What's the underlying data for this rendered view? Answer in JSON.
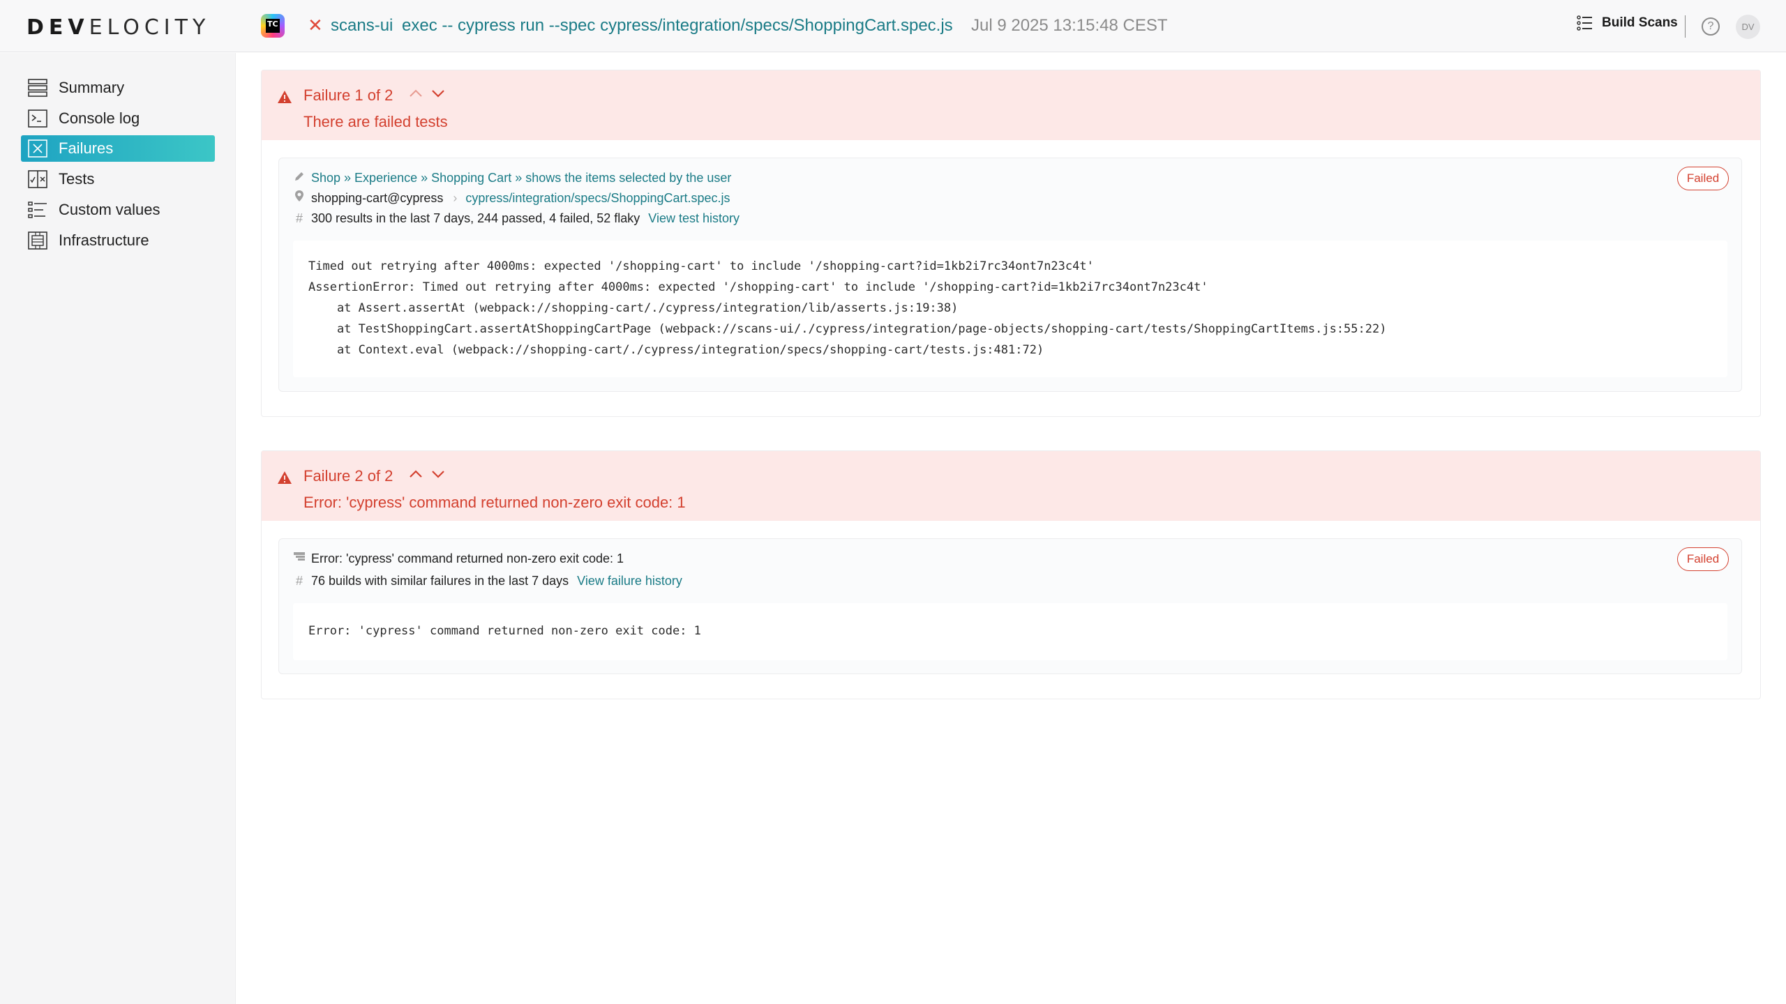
{
  "header": {
    "logo_bold": "DEV",
    "logo_light": "ELOCITY",
    "ci_logo_text": "TC",
    "status_icon": "x-icon",
    "project": "scans-ui",
    "command": "exec -- cypress run --spec cypress/integration/specs/ShoppingCart.spec.js",
    "timestamp": "Jul 9 2025 13:15:48 CEST",
    "build_scans_label": "Build Scans",
    "help_label": "?",
    "avatar_initials": "DV"
  },
  "sidebar": {
    "items": [
      {
        "label": "Summary",
        "icon": "summary-icon",
        "active": false
      },
      {
        "label": "Console log",
        "icon": "console-icon",
        "active": false
      },
      {
        "label": "Failures",
        "icon": "failures-icon",
        "active": true
      },
      {
        "label": "Tests",
        "icon": "tests-icon",
        "active": false
      },
      {
        "label": "Custom values",
        "icon": "custom-values-icon",
        "active": false
      },
      {
        "label": "Infrastructure",
        "icon": "infrastructure-icon",
        "active": false
      }
    ]
  },
  "failures": [
    {
      "title": "Failure 1 of 2",
      "message": "There are failed tests",
      "badge": "Failed",
      "test_path": "Shop » Experience » Shopping Cart » shows the items selected by the user",
      "task": "shopping-cart@cypress",
      "spec_file": "cypress/integration/specs/ShoppingCart.spec.js",
      "history_text": "300 results in the last 7 days, 244 passed, 4 failed, 52 flaky",
      "history_link": "View test history",
      "stacktrace": [
        "Timed out retrying after 4000ms: expected '/shopping-cart' to include '/shopping-cart?id=1kb2i7rc34ont7n23c4t'",
        "AssertionError: Timed out retrying after 4000ms: expected '/shopping-cart' to include '/shopping-cart?id=1kb2i7rc34ont7n23c4t'",
        "    at Assert.assertAt (webpack://shopping-cart/./cypress/integration/lib/asserts.js:19:38)",
        "    at TestShoppingCart.assertAtShoppingCartPage (webpack://scans-ui/./cypress/integration/page-objects/shopping-cart/tests/ShoppingCartItems.js:55:22)",
        "    at Context.eval (webpack://shopping-cart/./cypress/integration/specs/shopping-cart/tests.js:481:72)"
      ]
    },
    {
      "title": "Failure 2 of 2",
      "message": "Error: 'cypress' command returned non-zero exit code: 1",
      "badge": "Failed",
      "error_summary": "Error: 'cypress' command returned non-zero exit code: 1",
      "history_text": "76 builds with similar failures in the last 7 days",
      "history_link": "View failure history",
      "stacktrace": [
        "Error: 'cypress' command returned non-zero exit code: 1"
      ]
    }
  ],
  "colors": {
    "accent_teal": "#1a7b86",
    "failure_red": "#d3402f",
    "failure_bg": "#fde8e7",
    "active_nav_start": "#1ea3c2",
    "active_nav_end": "#3cc6c6"
  }
}
